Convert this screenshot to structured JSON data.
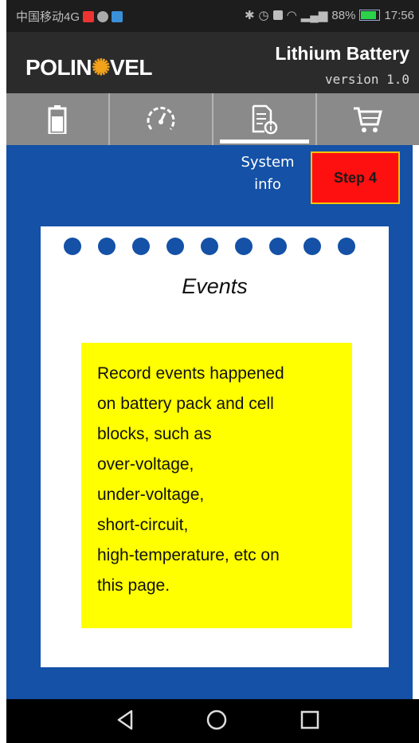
{
  "status_bar": {
    "carrier": "中国移动4G",
    "icons_left": [
      "notification-icon",
      "wechat-icon",
      "gallery-icon"
    ],
    "icons_right": [
      "bluetooth-icon",
      "alarm-icon",
      "hd-icon",
      "wifi-icon",
      "signal-icon"
    ],
    "battery": "88%",
    "time": "17:56"
  },
  "header": {
    "logo_text": "POLINOVEL",
    "title": "Lithium Battery",
    "version": "version 1.0"
  },
  "tabs": [
    {
      "icon": "battery-icon",
      "active": false
    },
    {
      "icon": "speedometer-icon",
      "active": false
    },
    {
      "icon": "system-info-icon",
      "active": true
    },
    {
      "icon": "shopping-cart-icon",
      "active": false
    }
  ],
  "active_tab_label": "System info",
  "step_badge": "Step 4",
  "card": {
    "title": "Events",
    "note_lines": [
      "Record events happened",
      "on battery pack and cell",
      "blocks, such as",
      "over-voltage,",
      "under-voltage,",
      "short-circuit,",
      "high-temperature, etc on",
      "this page."
    ]
  },
  "nav_bar": [
    "back-icon",
    "home-icon",
    "recents-icon"
  ],
  "colors": {
    "content_bg": "#1451a7",
    "header_bg": "#2b2b2b",
    "tab_bar_bg": "#8a8a8a",
    "badge_red": "#ff1010",
    "note_yellow": "#ffff00",
    "logo_accent": "#f3a31b"
  }
}
